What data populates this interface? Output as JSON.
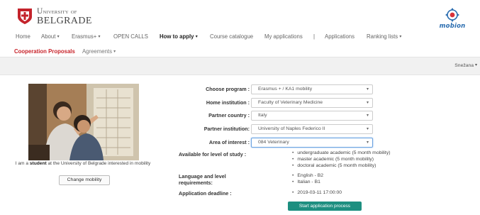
{
  "brand": {
    "university_line1_big": "U",
    "university_line1_rest": "NIVERSITY",
    "university_line1_of": "OF",
    "university_line2": "BELGRADE",
    "app_logo": "mobion",
    "shield_icon": "university-shield-icon",
    "app_icon": "mobion-target-icon"
  },
  "nav": {
    "home": "Home",
    "about": "About",
    "erasmus": "Erasmus+",
    "open_calls": "OPEN CALLS",
    "how_to_apply": "How to apply",
    "course_catalogue": "Course catalogue",
    "my_applications": "My applications",
    "separator": "|",
    "applications": "Applications",
    "ranking_lists": "Ranking lists",
    "caret": "▾"
  },
  "subnav": {
    "cooperation": "Cooperation Proposals",
    "agreements": "Agreements"
  },
  "user": {
    "name": "Snežana"
  },
  "profile": {
    "caption_pre": "I am a ",
    "caption_bold": "student",
    "caption_post": " at the University of Belgrade interested in mobility",
    "change_button": "Change mobility"
  },
  "form": {
    "program_label": "Choose program :",
    "program_value": "Erasmus + / KA1 mobility",
    "home_label": "Home institution :",
    "home_value": "Faculty of Veterinary Medicine",
    "country_label": "Partner country :",
    "country_value": "Italy",
    "partner_label": "Partner institution:",
    "partner_value": "University of Naples Federico II",
    "area_label": "Area of interest :",
    "area_value": "084 Veterinary",
    "select_arrow": "▾"
  },
  "info": {
    "study_label": "Available for level of study :",
    "study_levels": [
      "undergraduate academic (5 month mobility)",
      "master academic (5 month mobility)",
      "doctoral academic (5 month mobility)"
    ],
    "lang_label_1": "Language and level",
    "lang_label_2": "requirements:",
    "languages": [
      "English - B2",
      "Italian - B1"
    ],
    "deadline_label": "Application deadline :",
    "deadline_value": "2019-03-11 17:00:00"
  },
  "actions": {
    "start": "Start application process"
  }
}
